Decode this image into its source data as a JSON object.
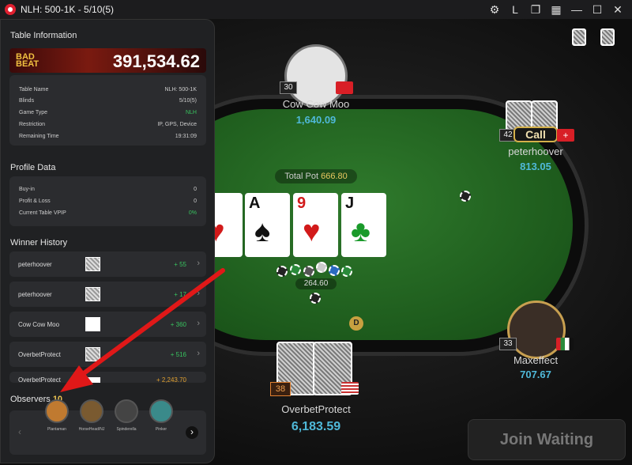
{
  "window": {
    "title": "NLH: 500-1K - 5/10(5)",
    "controls": [
      "⚙",
      "L",
      "❐",
      "▦",
      "—",
      "☐",
      "✕"
    ]
  },
  "panel": {
    "table_info_heading": "Table Information",
    "bad_beat_label": "BAD BEAT",
    "bad_beat_amount": "391,534.62",
    "table_info": [
      {
        "label": "Table Name",
        "value": "NLH: 500-1K"
      },
      {
        "label": "Blinds",
        "value": "5/10(5)"
      },
      {
        "label": "Game Type",
        "value": "NLH"
      },
      {
        "label": "Restriction",
        "value": "IP, GPS, Device"
      },
      {
        "label": "Remaining Time",
        "value": "19:31:09"
      }
    ],
    "profile_heading": "Profile Data",
    "profile": [
      {
        "label": "Buy-in",
        "value": "0"
      },
      {
        "label": "Profit & Loss",
        "value": "0"
      },
      {
        "label": "Current Table VPIP",
        "value": "0%"
      }
    ],
    "winner_heading": "Winner History",
    "winners": [
      {
        "name": "peterhoover",
        "amount": "+ 55"
      },
      {
        "name": "peterhoover",
        "amount": "+ 17"
      },
      {
        "name": "Cow Cow Moo",
        "amount": "+ 360"
      },
      {
        "name": "OverbetProtect",
        "amount": "+ 516"
      },
      {
        "name": "OverbetProtect",
        "amount": "+ 2,243.70"
      }
    ],
    "observers_label": "Observers",
    "observers_count": "10",
    "observers": [
      "Plantaman",
      "HorseHead/NJ",
      "Spinderella",
      "Pinker"
    ]
  },
  "table": {
    "total_pot_label": "Total Pot",
    "total_pot": "666.80",
    "bet_amount": "264.60",
    "community": [
      {
        "rank": "",
        "suit": "♥",
        "red": true
      },
      {
        "rank": "A",
        "suit": "♠",
        "red": false
      },
      {
        "rank": "9",
        "suit": "♥",
        "red": true
      },
      {
        "rank": "J",
        "suit": "♣",
        "red": false
      }
    ],
    "players": [
      {
        "name": "Cow Cow Moo",
        "stack": "1,640.09",
        "level": "30"
      },
      {
        "name": "peterhoover",
        "stack": "813.05",
        "level": "42",
        "action": "Call"
      },
      {
        "name": "Maxeffect",
        "stack": "707.67",
        "level": "33"
      },
      {
        "name": "OverbetProtect",
        "stack": "6,183.59",
        "level": "38"
      }
    ],
    "join_button": "Join Waiting"
  },
  "colors": {
    "felt": "#1d5a1c",
    "accent_green": "#38c35f",
    "stack_blue": "#4fb8d8",
    "arrow": "#e01818"
  }
}
